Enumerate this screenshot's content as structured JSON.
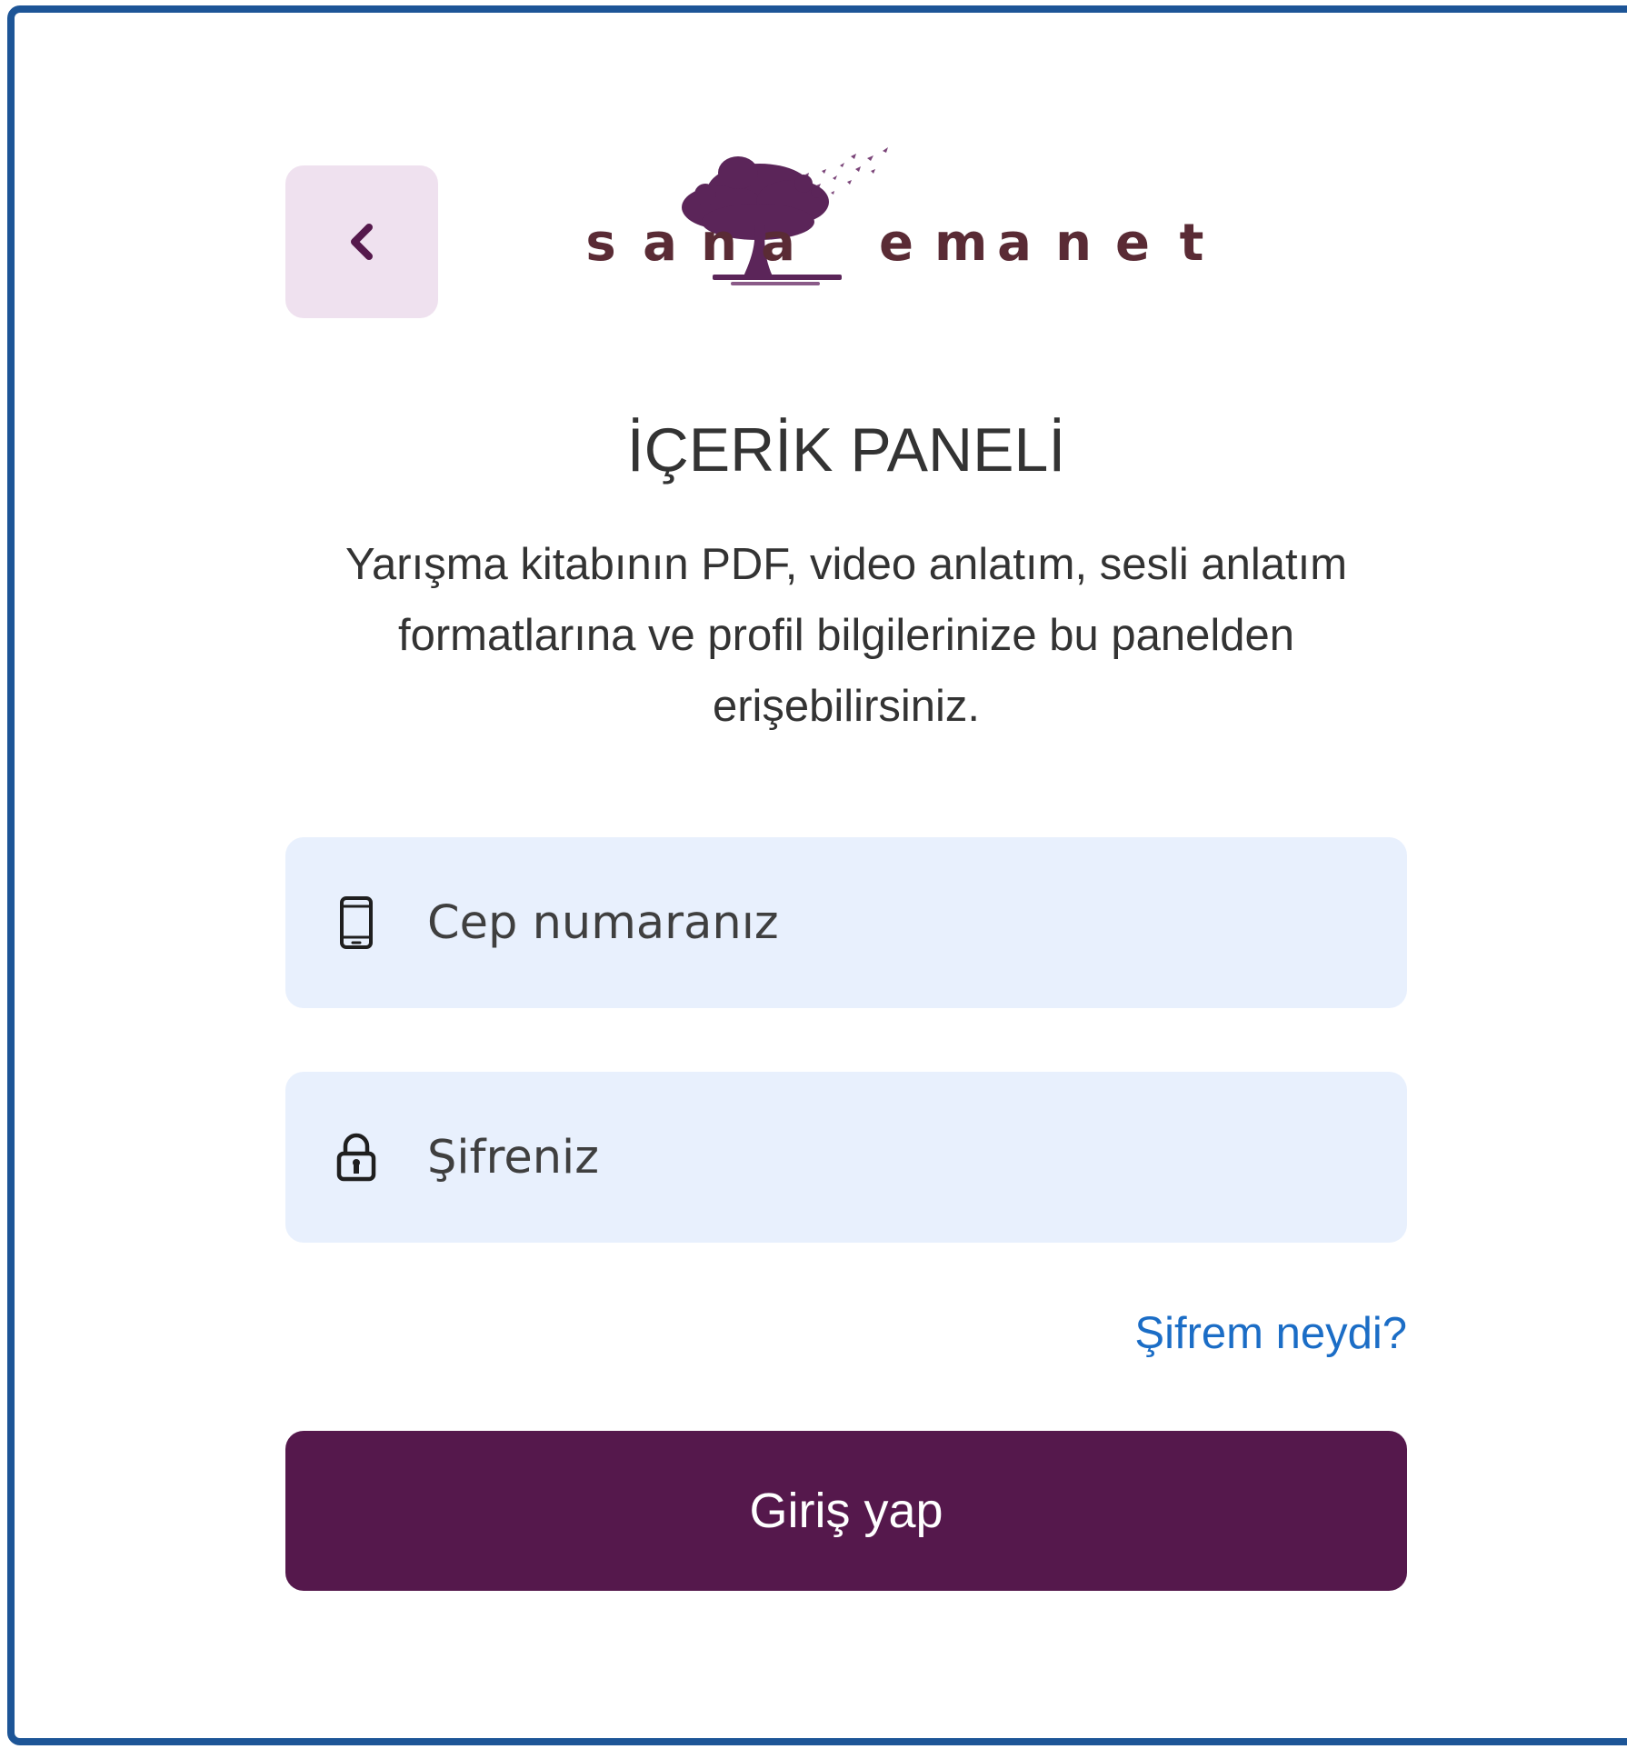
{
  "brand": {
    "logo_letters": [
      "s",
      "a",
      "n",
      "a",
      "",
      "e",
      "m",
      "a",
      "n",
      "e",
      "t"
    ],
    "logo_color": "#5a2b35",
    "tree_color": "#5b2559"
  },
  "back": {
    "icon": "chevron-left-icon",
    "color": "#55184c"
  },
  "page": {
    "title": "İÇERİK PANELİ",
    "description": "Yarışma kitabının PDF, video anlatım, sesli anlatım formatlarına ve profil bilgilerinize bu panelden erişebilirsiniz."
  },
  "form": {
    "phone": {
      "icon": "mobile-phone-icon",
      "placeholder": "Cep numaranız",
      "value": ""
    },
    "password": {
      "icon": "lock-icon",
      "placeholder": "Şifreniz",
      "value": ""
    },
    "forgot_label": "Şifrem neydi?",
    "submit_label": "Giriş yap"
  },
  "colors": {
    "frame_border": "#1d5597",
    "field_bg": "#e8f0fd",
    "button_bg": "#55184c",
    "link": "#1b6dc6",
    "back_bg": "#efe1ef"
  }
}
